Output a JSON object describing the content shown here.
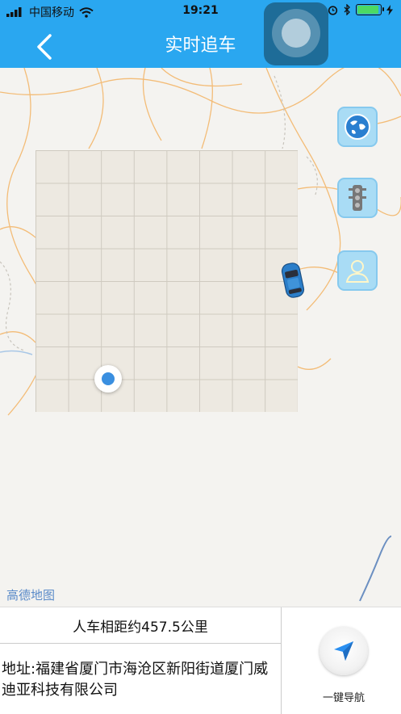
{
  "status_bar": {
    "carrier": "中国移动",
    "time": "19:21"
  },
  "header": {
    "title": "实时追车"
  },
  "map": {
    "logo_text": "高德地图",
    "buttons": [
      "globe-icon",
      "traffic-light-icon",
      "person-icon"
    ]
  },
  "bottom_panel": {
    "distance_text": "人车相距约457.5公里",
    "address_text": "地址:福建省厦门市海沧区新阳街道厦门威迪亚科技有限公司",
    "navigate_label": "一键导航"
  },
  "colors": {
    "header": "#2aa7f0",
    "accent": "#3a8fe0"
  }
}
